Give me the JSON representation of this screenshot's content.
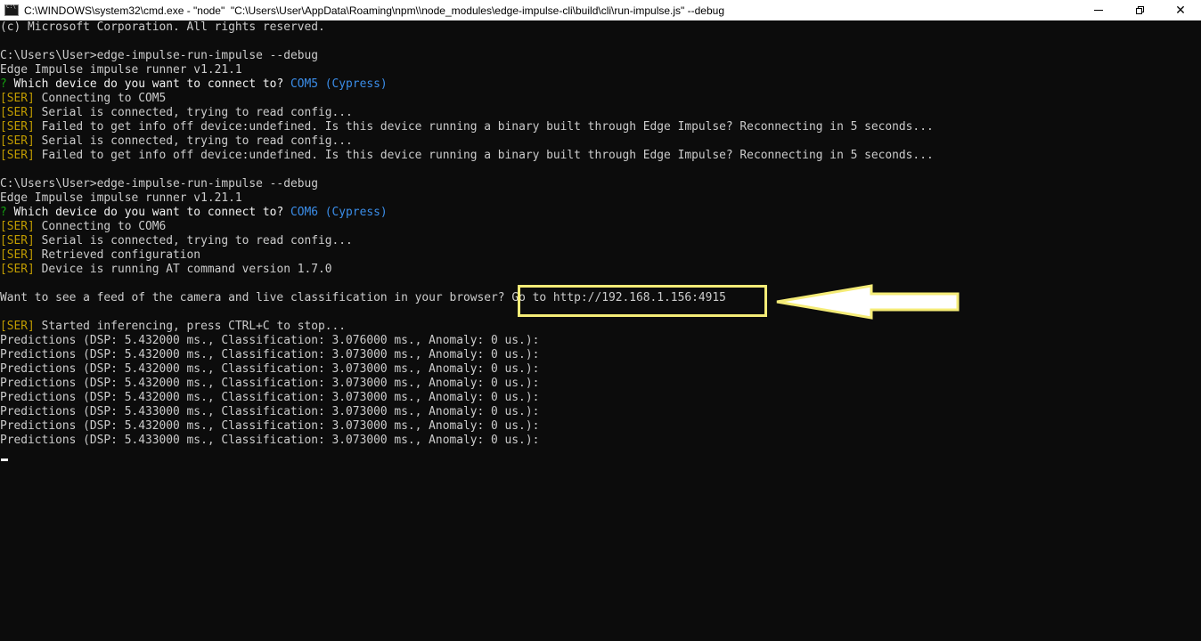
{
  "window": {
    "title": "C:\\WINDOWS\\system32\\cmd.exe - \"node\"  \"C:\\Users\\User\\AppData\\Roaming\\npm\\\\node_modules\\edge-impulse-cli\\build\\cli\\run-impulse.js\" --debug",
    "icon": "cmd-icon",
    "controls": {
      "minimize": "minimize",
      "maximize": "restore",
      "close": "close"
    }
  },
  "colors": {
    "background": "#0c0c0c",
    "text": "#cccccc",
    "ser_tag": "#c19c00",
    "question_mark": "#13a10e",
    "selected_device": "#3b8eea",
    "highlight_annotation": "#f5ec77"
  },
  "console": {
    "copyright": "(c) Microsoft Corporation. All rights reserved.",
    "run1": {
      "command": "C:\\Users\\User>edge-impulse-run-impulse --debug",
      "version": "Edge Impulse impulse runner v1.21.1",
      "q_mark": "?",
      "question": " Which device do you want to connect to?",
      "answer": " COM5 (Cypress)",
      "tag": "[SER]",
      "msg1": " Connecting to COM5",
      "msg2": " Serial is connected, trying to read config...",
      "msg3": " Failed to get info off device:undefined. Is this device running a binary built through Edge Impulse? Reconnecting in 5 seconds...",
      "msg4": " Serial is connected, trying to read config...",
      "msg5": " Failed to get info off device:undefined. Is this device running a binary built through Edge Impulse? Reconnecting in 5 seconds..."
    },
    "run2": {
      "command": "C:\\Users\\User>edge-impulse-run-impulse --debug",
      "version": "Edge Impulse impulse runner v1.21.1",
      "q_mark": "?",
      "question": " Which device do you want to connect to?",
      "answer": " COM6 (Cypress)",
      "tag": "[SER]",
      "msg1": " Connecting to COM6",
      "msg2": " Serial is connected, trying to read config...",
      "msg3": " Retrieved configuration",
      "msg4": " Device is running AT command version 1.7.0"
    },
    "feed_prompt": "Want to see a feed of the camera and live classification in your browser? ",
    "feed_url": "Go to http://192.168.1.156:4915",
    "inference_tag": "[SER]",
    "inference_msg": " Started inferencing, press CTRL+C to stop...",
    "predictions": [
      "Predictions (DSP: 5.432000 ms., Classification: 3.076000 ms., Anomaly: 0 us.):",
      "Predictions (DSP: 5.432000 ms., Classification: 3.073000 ms., Anomaly: 0 us.):",
      "Predictions (DSP: 5.432000 ms., Classification: 3.073000 ms., Anomaly: 0 us.):",
      "Predictions (DSP: 5.432000 ms., Classification: 3.073000 ms., Anomaly: 0 us.):",
      "Predictions (DSP: 5.432000 ms., Classification: 3.073000 ms., Anomaly: 0 us.):",
      "Predictions (DSP: 5.433000 ms., Classification: 3.073000 ms., Anomaly: 0 us.):",
      "Predictions (DSP: 5.432000 ms., Classification: 3.073000 ms., Anomaly: 0 us.):",
      "Predictions (DSP: 5.433000 ms., Classification: 3.073000 ms., Anomaly: 0 us.):"
    ]
  },
  "annotations": {
    "highlight_box": "url-highlight-box",
    "arrow": "arrow-pointing-left"
  }
}
